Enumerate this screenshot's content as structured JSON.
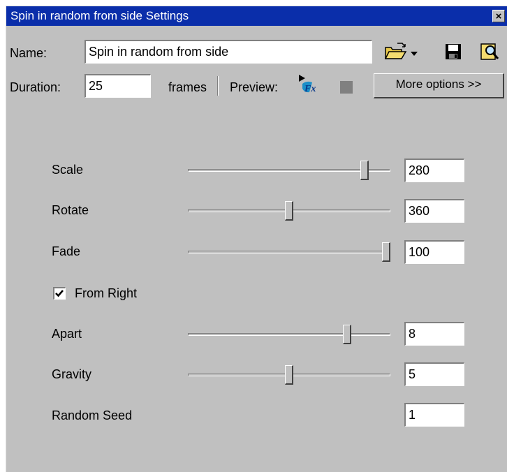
{
  "window": {
    "title": "Spin in random from side Settings",
    "close_label": "×"
  },
  "header": {
    "name_label": "Name:",
    "name_value": "Spin in random from side",
    "duration_label": "Duration:",
    "duration_value": "25",
    "frames_label": "frames",
    "preview_label": "Preview:",
    "more_options_label": "More options >>",
    "icons": [
      "open-folder-icon",
      "dropdown-arrow-icon",
      "save-icon",
      "find-icon",
      "preview-fx-icon",
      "stop-icon"
    ]
  },
  "params": {
    "scale": {
      "label": "Scale",
      "value": "280",
      "slider_fraction": 0.89
    },
    "rotate": {
      "label": "Rotate",
      "value": "360",
      "slider_fraction": 0.5
    },
    "fade": {
      "label": "Fade",
      "value": "100",
      "slider_fraction": 1.0
    },
    "from_right": {
      "label": "From Right",
      "checked": true
    },
    "apart": {
      "label": "Apart",
      "value": "8",
      "slider_fraction": 0.8
    },
    "gravity": {
      "label": "Gravity",
      "value": "5",
      "slider_fraction": 0.5
    },
    "random_seed": {
      "label": "Random Seed",
      "value": "1"
    }
  },
  "colors": {
    "titlebar": "#0a2eaa",
    "face": "#c0c0c0"
  }
}
